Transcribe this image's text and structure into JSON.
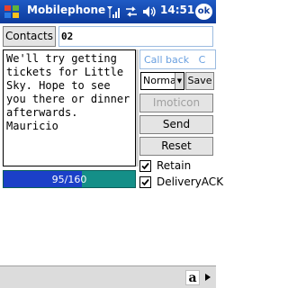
{
  "titlebar": {
    "title": "Mobilephone",
    "clock": "14:51",
    "ok_label": "ok",
    "icons": [
      "windows-start-icon",
      "signal-icon",
      "connectivity-icon",
      "volume-icon"
    ]
  },
  "recipient": {
    "contacts_label": "Contacts",
    "number_value": "02"
  },
  "message": {
    "text": "We'll try getting tickets for Little Sky. Hope to see you there or dinner afterwards. Mauricio",
    "counter_text": "95/160",
    "counter_used": 95,
    "counter_max": 160
  },
  "options": {
    "callback_value": "Call back",
    "callback_value_extra": "C",
    "priority_value": "Norma",
    "save_label": "Save",
    "imoticon_label": "Imoticon",
    "send_label": "Send",
    "reset_label": "Reset",
    "retain_label": "Retain",
    "retain_checked": true,
    "delivery_label": "DeliveryACK",
    "delivery_checked": true
  },
  "bottom_bar": {
    "keyboard_label": "a",
    "icons": [
      "keyboard-icon",
      "input-menu-arrow-icon"
    ]
  },
  "colors": {
    "titlebar": "#1f5bc5",
    "progress_fill": "#1b40c8",
    "progress_bg": "#148f88",
    "field_border": "#9bbbe0"
  }
}
